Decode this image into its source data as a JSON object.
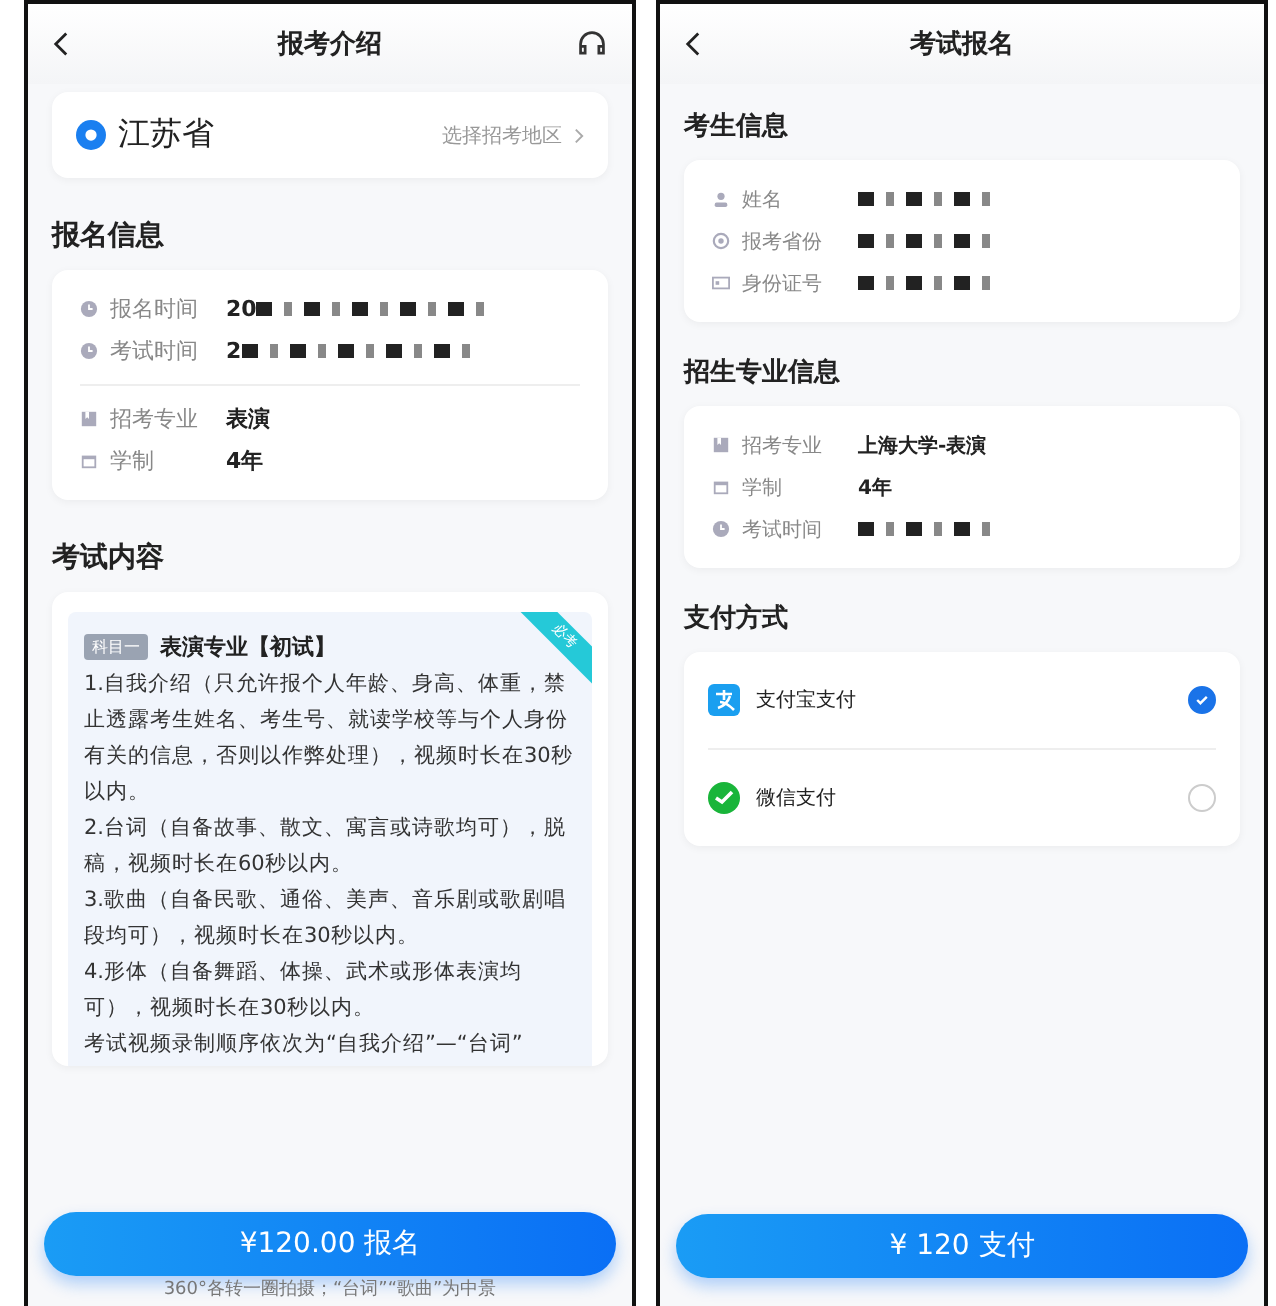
{
  "screens": [
    {
      "header": {
        "title": "报考介绍",
        "support_icon": true
      },
      "province": {
        "name": "江苏省",
        "link": "选择招考地区"
      },
      "sections": [
        {
          "title": "报名信息",
          "groups": [
            [
              {
                "kind": "clock",
                "label": "报名时间",
                "value": "20",
                "redacted": true
              },
              {
                "kind": "clock",
                "label": "考试时间",
                "value": "2",
                "redacted": true
              }
            ],
            [
              {
                "kind": "book",
                "label": "招考专业",
                "value": "表演",
                "redacted": false
              },
              {
                "kind": "calendar",
                "label": "学制",
                "value": "4年",
                "redacted": false
              }
            ]
          ]
        }
      ],
      "exam": {
        "title": "考试内容",
        "tag": "科目一",
        "subject": "表演专业【初试】",
        "corner": "必考",
        "paragraphs": [
          "1.自我介绍（只允许报个人年龄、身高、体重，禁止透露考生姓名、考生号、就读学校等与个人身份有关的信息，否则以作弊处理），视频时长在30秒以内。",
          "2.台词（自备故事、散文、寓言或诗歌均可），脱稿，视频时长在60秒以内。",
          "3.歌曲（自备民歌、通俗、美声、音乐剧或歌剧唱段均可），视频时长在30秒以内。",
          "4.形体（自备舞蹈、体操、武术或形体表演均可），视频时长在30秒以内。",
          "考试视频录制顺序依次为“自我介绍”—“台词”"
        ],
        "cut_line": "360°各转一圈拍摄；“台词”“歌曲”为中景"
      },
      "button": "¥120.00 报名"
    },
    {
      "header": {
        "title": "考试报名",
        "support_icon": false
      },
      "sections": [
        {
          "title": "考生信息",
          "groups": [
            [
              {
                "kind": "person",
                "label": "姓名",
                "redacted": true
              },
              {
                "kind": "pin",
                "label": "报考省份",
                "redacted": true
              },
              {
                "kind": "idcard",
                "label": "身份证号",
                "redacted": true
              }
            ]
          ]
        },
        {
          "title": "招生专业信息",
          "groups": [
            [
              {
                "kind": "book",
                "label": "招考专业",
                "value": "上海大学-表演",
                "redacted": false
              },
              {
                "kind": "calendar",
                "label": "学制",
                "value": "4年",
                "redacted": false
              },
              {
                "kind": "clock",
                "label": "考试时间",
                "redacted": true
              }
            ]
          ]
        }
      ],
      "payment": {
        "title": "支付方式",
        "methods": [
          {
            "kind": "alipay",
            "label": "支付宝支付",
            "selected": true
          },
          {
            "kind": "wechat",
            "label": "微信支付",
            "selected": false
          }
        ]
      },
      "button": "¥ 120  支付"
    }
  ]
}
